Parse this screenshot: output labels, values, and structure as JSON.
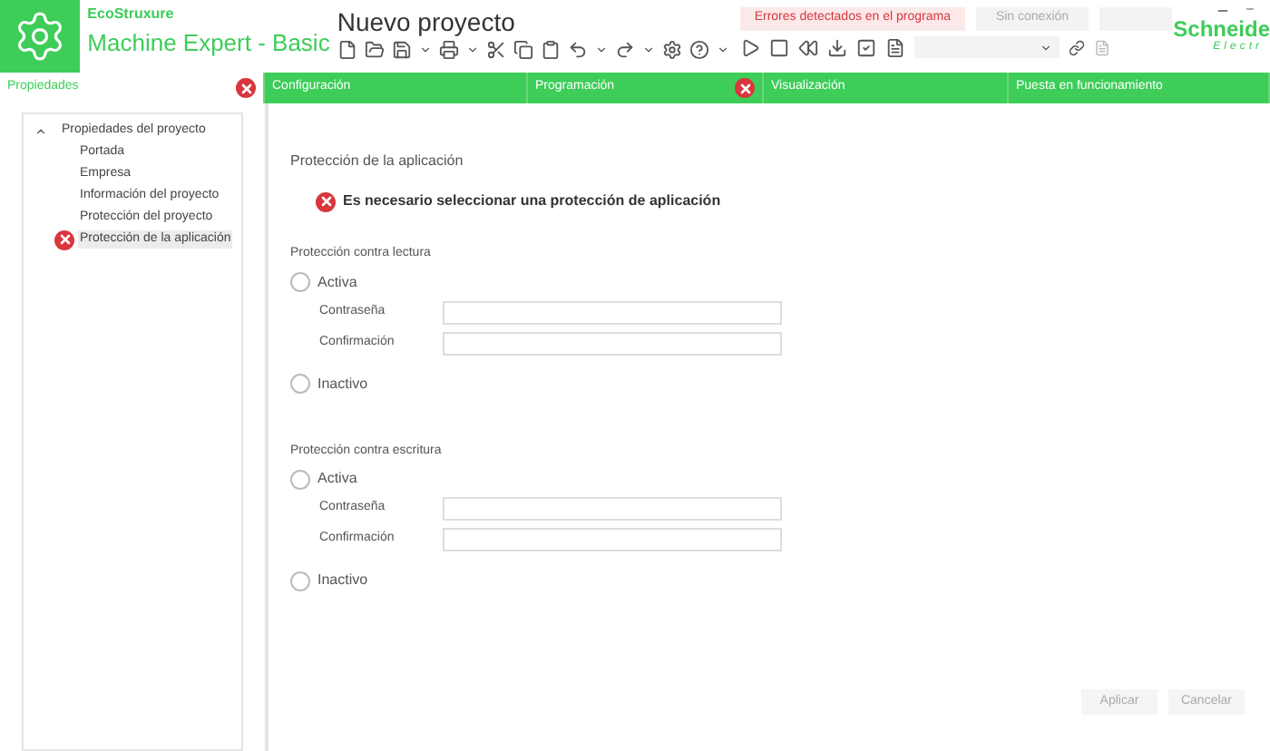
{
  "header": {
    "brand": "EcoStruxure",
    "product": "Machine Expert - Basic",
    "project_title": "Nuevo proyecto",
    "status": [
      {
        "text": "Errores detectados en el programa",
        "kind": "error"
      },
      {
        "text": "Sin conexión",
        "kind": "offline"
      }
    ],
    "vendor": "Schneide",
    "vendor_sub": "Electr"
  },
  "tabs": [
    {
      "label": "Propiedades",
      "selected": true,
      "error": true
    },
    {
      "label": "Configuración",
      "selected": false,
      "error": false
    },
    {
      "label": "Programación",
      "selected": false,
      "error": true
    },
    {
      "label": "Visualización",
      "selected": false,
      "error": false
    },
    {
      "label": "Puesta en funcionamiento",
      "selected": false,
      "error": false
    }
  ],
  "tree": {
    "label": "Propiedades del proyecto",
    "expanded": true,
    "children": [
      {
        "label": "Portada",
        "selected": false,
        "error": false
      },
      {
        "label": "Empresa",
        "selected": false,
        "error": false
      },
      {
        "label": "Información del proyecto",
        "selected": false,
        "error": false
      },
      {
        "label": "Protección del proyecto",
        "selected": false,
        "error": false
      },
      {
        "label": "Protección de la aplicación",
        "selected": true,
        "error": true
      }
    ]
  },
  "content": {
    "title": "Protección de la aplicación",
    "error_message": "Es necesario seleccionar una protección de aplicación",
    "sections": [
      {
        "title": "Protección contra lectura",
        "active": {
          "label": "Activa",
          "selected": false
        },
        "fields": [
          {
            "label": "Contraseña"
          },
          {
            "label": "Confirmación"
          }
        ],
        "inactive": {
          "label": "Inactivo",
          "selected": false
        }
      },
      {
        "title": "Protección contra escritura",
        "active": {
          "label": "Activa",
          "selected": false
        },
        "fields": [
          {
            "label": "Contraseña"
          },
          {
            "label": "Confirmación"
          }
        ],
        "inactive": {
          "label": "Inactivo",
          "selected": false
        }
      }
    ]
  },
  "buttons": [
    {
      "label": "Aplicar",
      "disabled": true
    },
    {
      "label": "Cancelar",
      "disabled": true
    }
  ]
}
